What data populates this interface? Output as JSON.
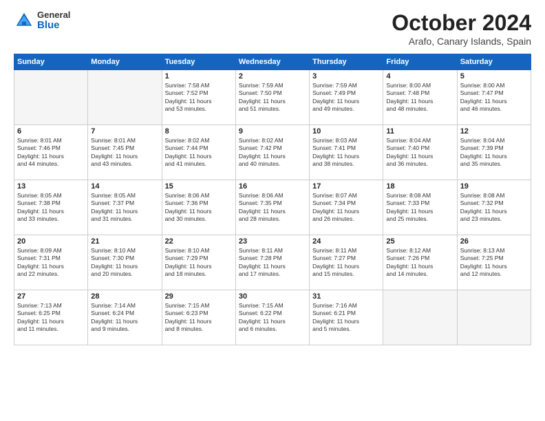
{
  "header": {
    "logo_general": "General",
    "logo_blue": "Blue",
    "month_title": "October 2024",
    "location": "Arafo, Canary Islands, Spain"
  },
  "days_of_week": [
    "Sunday",
    "Monday",
    "Tuesday",
    "Wednesday",
    "Thursday",
    "Friday",
    "Saturday"
  ],
  "weeks": [
    [
      {
        "day": "",
        "info": ""
      },
      {
        "day": "",
        "info": ""
      },
      {
        "day": "1",
        "info": "Sunrise: 7:58 AM\nSunset: 7:52 PM\nDaylight: 11 hours\nand 53 minutes."
      },
      {
        "day": "2",
        "info": "Sunrise: 7:59 AM\nSunset: 7:50 PM\nDaylight: 11 hours\nand 51 minutes."
      },
      {
        "day": "3",
        "info": "Sunrise: 7:59 AM\nSunset: 7:49 PM\nDaylight: 11 hours\nand 49 minutes."
      },
      {
        "day": "4",
        "info": "Sunrise: 8:00 AM\nSunset: 7:48 PM\nDaylight: 11 hours\nand 48 minutes."
      },
      {
        "day": "5",
        "info": "Sunrise: 8:00 AM\nSunset: 7:47 PM\nDaylight: 11 hours\nand 46 minutes."
      }
    ],
    [
      {
        "day": "6",
        "info": "Sunrise: 8:01 AM\nSunset: 7:46 PM\nDaylight: 11 hours\nand 44 minutes."
      },
      {
        "day": "7",
        "info": "Sunrise: 8:01 AM\nSunset: 7:45 PM\nDaylight: 11 hours\nand 43 minutes."
      },
      {
        "day": "8",
        "info": "Sunrise: 8:02 AM\nSunset: 7:44 PM\nDaylight: 11 hours\nand 41 minutes."
      },
      {
        "day": "9",
        "info": "Sunrise: 8:02 AM\nSunset: 7:42 PM\nDaylight: 11 hours\nand 40 minutes."
      },
      {
        "day": "10",
        "info": "Sunrise: 8:03 AM\nSunset: 7:41 PM\nDaylight: 11 hours\nand 38 minutes."
      },
      {
        "day": "11",
        "info": "Sunrise: 8:04 AM\nSunset: 7:40 PM\nDaylight: 11 hours\nand 36 minutes."
      },
      {
        "day": "12",
        "info": "Sunrise: 8:04 AM\nSunset: 7:39 PM\nDaylight: 11 hours\nand 35 minutes."
      }
    ],
    [
      {
        "day": "13",
        "info": "Sunrise: 8:05 AM\nSunset: 7:38 PM\nDaylight: 11 hours\nand 33 minutes."
      },
      {
        "day": "14",
        "info": "Sunrise: 8:05 AM\nSunset: 7:37 PM\nDaylight: 11 hours\nand 31 minutes."
      },
      {
        "day": "15",
        "info": "Sunrise: 8:06 AM\nSunset: 7:36 PM\nDaylight: 11 hours\nand 30 minutes."
      },
      {
        "day": "16",
        "info": "Sunrise: 8:06 AM\nSunset: 7:35 PM\nDaylight: 11 hours\nand 28 minutes."
      },
      {
        "day": "17",
        "info": "Sunrise: 8:07 AM\nSunset: 7:34 PM\nDaylight: 11 hours\nand 26 minutes."
      },
      {
        "day": "18",
        "info": "Sunrise: 8:08 AM\nSunset: 7:33 PM\nDaylight: 11 hours\nand 25 minutes."
      },
      {
        "day": "19",
        "info": "Sunrise: 8:08 AM\nSunset: 7:32 PM\nDaylight: 11 hours\nand 23 minutes."
      }
    ],
    [
      {
        "day": "20",
        "info": "Sunrise: 8:09 AM\nSunset: 7:31 PM\nDaylight: 11 hours\nand 22 minutes."
      },
      {
        "day": "21",
        "info": "Sunrise: 8:10 AM\nSunset: 7:30 PM\nDaylight: 11 hours\nand 20 minutes."
      },
      {
        "day": "22",
        "info": "Sunrise: 8:10 AM\nSunset: 7:29 PM\nDaylight: 11 hours\nand 18 minutes."
      },
      {
        "day": "23",
        "info": "Sunrise: 8:11 AM\nSunset: 7:28 PM\nDaylight: 11 hours\nand 17 minutes."
      },
      {
        "day": "24",
        "info": "Sunrise: 8:11 AM\nSunset: 7:27 PM\nDaylight: 11 hours\nand 15 minutes."
      },
      {
        "day": "25",
        "info": "Sunrise: 8:12 AM\nSunset: 7:26 PM\nDaylight: 11 hours\nand 14 minutes."
      },
      {
        "day": "26",
        "info": "Sunrise: 8:13 AM\nSunset: 7:25 PM\nDaylight: 11 hours\nand 12 minutes."
      }
    ],
    [
      {
        "day": "27",
        "info": "Sunrise: 7:13 AM\nSunset: 6:25 PM\nDaylight: 11 hours\nand 11 minutes."
      },
      {
        "day": "28",
        "info": "Sunrise: 7:14 AM\nSunset: 6:24 PM\nDaylight: 11 hours\nand 9 minutes."
      },
      {
        "day": "29",
        "info": "Sunrise: 7:15 AM\nSunset: 6:23 PM\nDaylight: 11 hours\nand 8 minutes."
      },
      {
        "day": "30",
        "info": "Sunrise: 7:15 AM\nSunset: 6:22 PM\nDaylight: 11 hours\nand 6 minutes."
      },
      {
        "day": "31",
        "info": "Sunrise: 7:16 AM\nSunset: 6:21 PM\nDaylight: 11 hours\nand 5 minutes."
      },
      {
        "day": "",
        "info": ""
      },
      {
        "day": "",
        "info": ""
      }
    ]
  ]
}
